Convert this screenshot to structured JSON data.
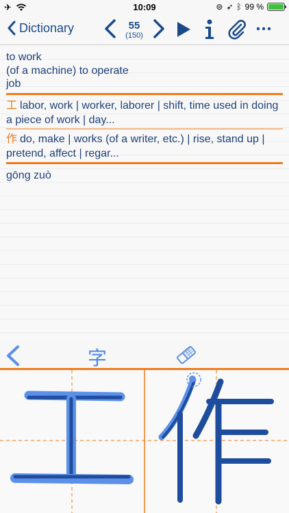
{
  "status": {
    "time": "10:09",
    "battery_text": "99 %",
    "battery_level": 0.99
  },
  "nav": {
    "back_label": "Dictionary",
    "page_current": "55",
    "page_total": "(150)"
  },
  "entry": {
    "definitions": [
      "to work",
      "(of a machine) to operate",
      "job"
    ],
    "characters": [
      {
        "hanzi": "工",
        "gloss": "labor, work | worker, laborer | shift, time used in doing a piece of work | day..."
      },
      {
        "hanzi": "作",
        "gloss": "do, make | works (of a writer, etc.) | rise, stand up | pretend, affect | regar..."
      }
    ],
    "pinyin": "gōng zuò"
  },
  "toolbar": {
    "char_mode_glyph": "字"
  },
  "writing": {
    "boxes": [
      {
        "hanzi": "工"
      },
      {
        "hanzi": "作"
      }
    ]
  },
  "colors": {
    "accent": "#f07a1a",
    "ink_dark": "#1f4d9e",
    "ink_light": "#5b8fe8",
    "text": "#1f3f7a"
  }
}
